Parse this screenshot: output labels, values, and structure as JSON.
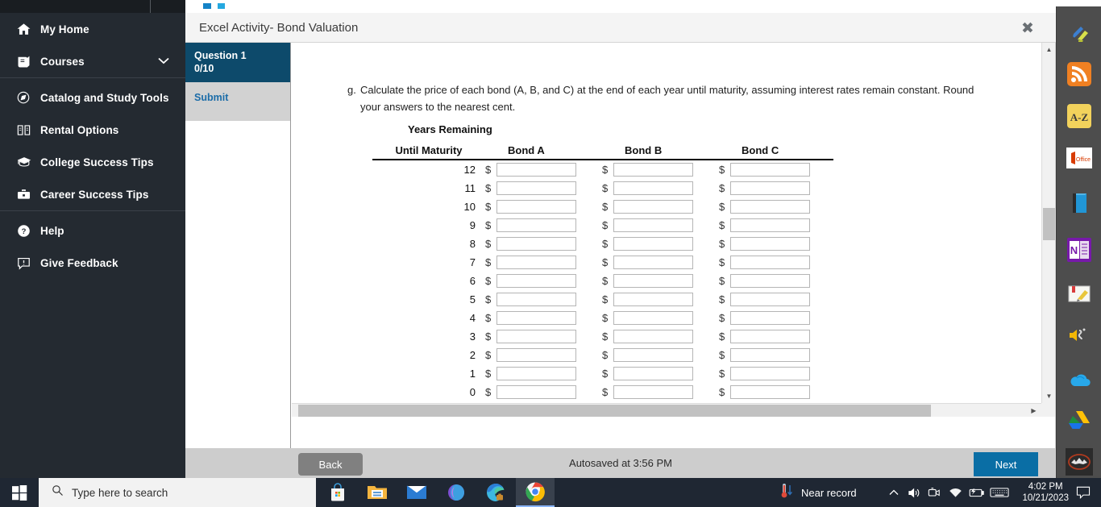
{
  "sidebar": {
    "items": [
      {
        "label": "My Home",
        "icon": "home-icon",
        "has_chevron": false
      },
      {
        "label": "Courses",
        "icon": "book-icon",
        "has_chevron": true
      },
      {
        "label": "Catalog and Study Tools",
        "icon": "compass-icon",
        "has_chevron": false
      },
      {
        "label": "Rental Options",
        "icon": "open-book-icon",
        "has_chevron": false
      },
      {
        "label": "College Success Tips",
        "icon": "graduation-cap-icon",
        "has_chevron": false
      },
      {
        "label": "Career Success Tips",
        "icon": "briefcase-icon",
        "has_chevron": false
      },
      {
        "label": "Help",
        "icon": "question-circle-icon",
        "has_chevron": false
      },
      {
        "label": "Give Feedback",
        "icon": "feedback-icon",
        "has_chevron": false
      }
    ]
  },
  "activity": {
    "title": "Excel Activity- Bond Valuation",
    "close_label": "✖",
    "qnav": {
      "question_label": "Question 1",
      "score": "0/10",
      "submit_label": "Submit"
    },
    "question": {
      "letter": "g.",
      "line1": "Calculate the price of each bond (A, B, and C) at the end of each year until maturity, assuming interest rates remain constant. Round",
      "line2": "your answers to the nearest cent."
    },
    "table": {
      "header_line1": "Years Remaining",
      "header_line2": "Until Maturity",
      "columns": [
        "Bond A",
        "Bond B",
        "Bond C"
      ],
      "currency_symbol": "$",
      "rows": [
        {
          "years": "12",
          "bond_a": "",
          "bond_b": "",
          "bond_c": ""
        },
        {
          "years": "11",
          "bond_a": "",
          "bond_b": "",
          "bond_c": ""
        },
        {
          "years": "10",
          "bond_a": "",
          "bond_b": "",
          "bond_c": ""
        },
        {
          "years": "9",
          "bond_a": "",
          "bond_b": "",
          "bond_c": ""
        },
        {
          "years": "8",
          "bond_a": "",
          "bond_b": "",
          "bond_c": ""
        },
        {
          "years": "7",
          "bond_a": "",
          "bond_b": "",
          "bond_c": ""
        },
        {
          "years": "6",
          "bond_a": "",
          "bond_b": "",
          "bond_c": ""
        },
        {
          "years": "5",
          "bond_a": "",
          "bond_b": "",
          "bond_c": ""
        },
        {
          "years": "4",
          "bond_a": "",
          "bond_b": "",
          "bond_c": ""
        },
        {
          "years": "3",
          "bond_a": "",
          "bond_b": "",
          "bond_c": ""
        },
        {
          "years": "2",
          "bond_a": "",
          "bond_b": "",
          "bond_c": ""
        },
        {
          "years": "1",
          "bond_a": "",
          "bond_b": "",
          "bond_c": ""
        },
        {
          "years": "0",
          "bond_a": "",
          "bond_b": "",
          "bond_c": ""
        }
      ]
    },
    "footer": {
      "back_label": "Back",
      "autosave_text": "Autosaved at 3:56 PM",
      "next_label": "Next"
    }
  },
  "app_rail": {
    "icons": [
      "pen-highlighter-icon",
      "rss-feed-icon",
      "a-z-dictionary-icon",
      "office-icon",
      "blue-book-icon",
      "onenote-icon",
      "notebook-highlighter-icon",
      "text-to-speech-icon",
      "onedrive-icon",
      "google-drive-icon",
      "bat-icon"
    ]
  },
  "taskbar": {
    "start_label": "start-button",
    "search_placeholder": "Type here to search",
    "apps": [
      "microsoft-store-icon",
      "file-explorer-icon",
      "mail-icon",
      "microsoft-365-icon",
      "microsoft-edge-icon",
      "google-chrome-icon"
    ],
    "tray": {
      "weather_text": "Near record",
      "weather_icon": "thermometer-icon",
      "overflow_icon": "chevron-up-icon",
      "volume_icon": "speaker-icon",
      "meet_now_icon": "meet-now-icon",
      "network_icon": "wifi-icon",
      "battery_icon": "battery-charging-icon",
      "keyboard_icon": "keyboard-icon",
      "time": "4:02 PM",
      "date": "10/21/2023",
      "notifications_icon": "notification-icon"
    }
  },
  "colors": {
    "sidebar_bg": "#242a31",
    "qnav_active": "#0d4a6b",
    "next_button": "#0a6ea5",
    "back_button": "#808080",
    "taskbar": "#1f2733",
    "app_rail": "#4d4d4d"
  }
}
